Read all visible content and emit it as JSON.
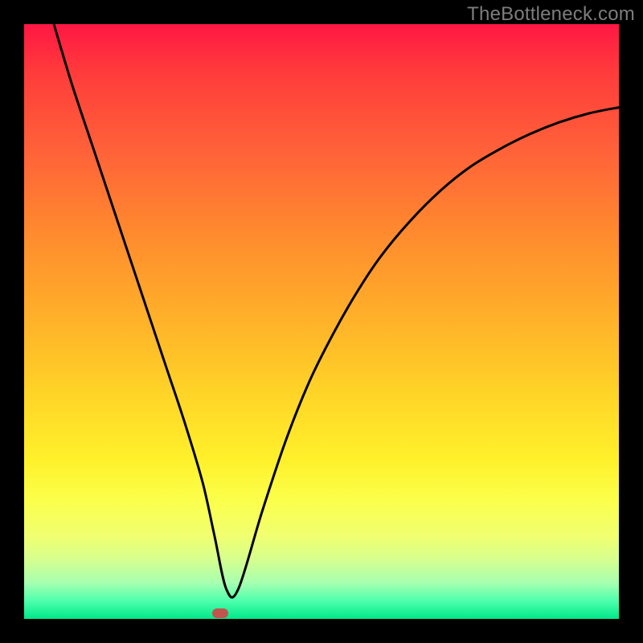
{
  "watermark": "TheBottleneck.com",
  "chart_data": {
    "type": "line",
    "title": "",
    "xlabel": "",
    "ylabel": "",
    "xlim": [
      0,
      100
    ],
    "ylim": [
      0,
      100
    ],
    "grid": false,
    "curve": {
      "name": "bottleneck-curve",
      "x": [
        5,
        8,
        12,
        16,
        20,
        24,
        27,
        30,
        32,
        34,
        36,
        40,
        44,
        48,
        52,
        56,
        60,
        65,
        70,
        75,
        80,
        85,
        90,
        95,
        100
      ],
      "y": [
        100,
        90,
        78,
        66,
        54,
        42,
        33,
        23,
        14,
        5,
        5,
        18,
        30,
        40,
        48,
        55,
        61,
        67,
        72,
        76,
        79,
        81.5,
        83.5,
        85,
        86
      ]
    },
    "minimum_marker": {
      "x": 33,
      "y": 1
    },
    "gradient_stops": [
      {
        "pos": 0,
        "color": "#ff1744"
      },
      {
        "pos": 50,
        "color": "#ffd428"
      },
      {
        "pos": 80,
        "color": "#fbff4a"
      },
      {
        "pos": 100,
        "color": "#00e88a"
      }
    ]
  }
}
